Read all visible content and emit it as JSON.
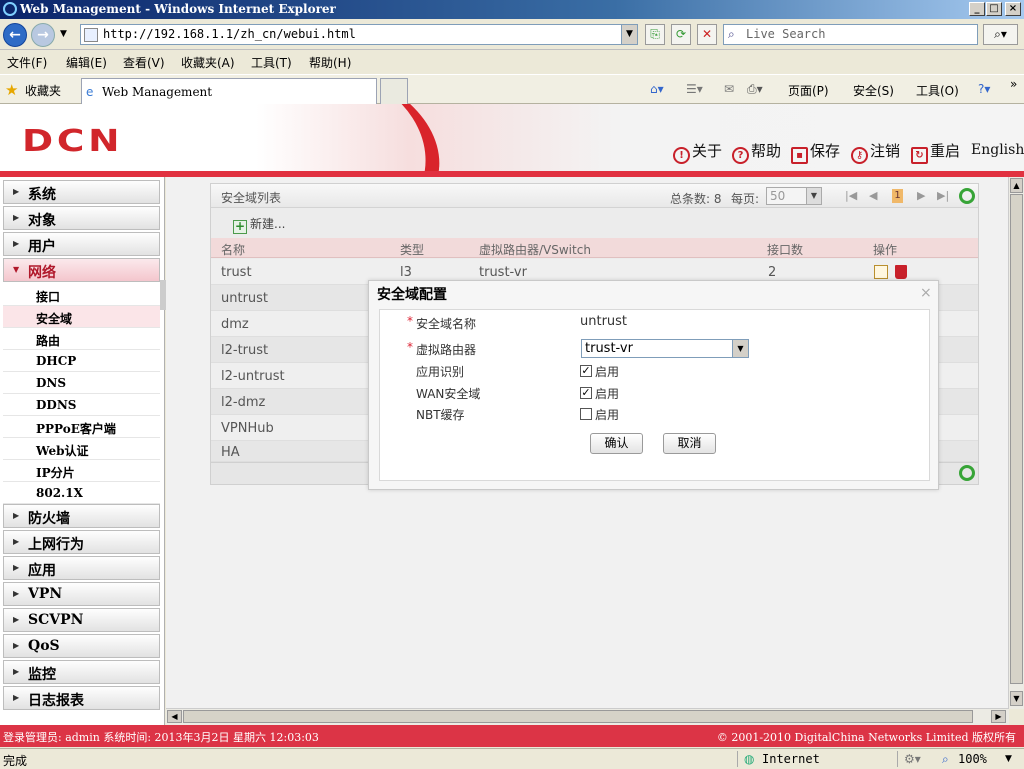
{
  "window": {
    "title": "Web Management - Windows Internet Explorer"
  },
  "addressbar": {
    "url": "http://192.168.1.1/zh_cn/webui.html",
    "search_placeholder": "Live Search"
  },
  "menubar": {
    "items": [
      "文件(F)",
      "编辑(E)",
      "查看(V)",
      "收藏夹(A)",
      "工具(T)",
      "帮助(H)"
    ]
  },
  "favbar": {
    "favorites_label": "收藏夹",
    "tab_title": "Web Management",
    "tools": [
      "页面(P)",
      "安全(S)",
      "工具(O)"
    ]
  },
  "banner": {
    "logo": "DCN",
    "links": [
      "关于",
      "帮助",
      "保存",
      "注销",
      "重启",
      "English"
    ]
  },
  "sidebar": {
    "groups": [
      "系统",
      "对象",
      "用户",
      "网络",
      "防火墙",
      "上网行为",
      "应用",
      "VPN",
      "SCVPN",
      "QoS",
      "监控",
      "日志报表"
    ],
    "network_sub": [
      "接口",
      "安全域",
      "路由",
      "DHCP",
      "DNS",
      "DDNS",
      "PPPoE客户端",
      "Web认证",
      "IP分片",
      "802.1X"
    ]
  },
  "panel": {
    "title": "安全域列表",
    "total_label": "总条数: 8",
    "per_page_label": "每页:",
    "per_page_value": "50",
    "current_page": "1",
    "new_button": "新建...",
    "columns": [
      "名称",
      "类型",
      "虚拟路由器/VSwitch",
      "接口数",
      "操作"
    ],
    "rows": [
      {
        "name": "trust",
        "type": "l3",
        "vr": "trust-vr",
        "count": "2"
      },
      {
        "name": "untrust",
        "type": "",
        "vr": "",
        "count": ""
      },
      {
        "name": "dmz",
        "type": "",
        "vr": "",
        "count": ""
      },
      {
        "name": "l2-trust",
        "type": "",
        "vr": "",
        "count": ""
      },
      {
        "name": "l2-untrust",
        "type": "",
        "vr": "",
        "count": ""
      },
      {
        "name": "l2-dmz",
        "type": "",
        "vr": "",
        "count": ""
      },
      {
        "name": "VPNHub",
        "type": "",
        "vr": "",
        "count": ""
      },
      {
        "name": "HA",
        "type": "",
        "vr": "",
        "count": ""
      }
    ]
  },
  "modal": {
    "title": "安全域配置",
    "close": "×",
    "zone_name_label": "安全域名称",
    "zone_name_value": "untrust",
    "vr_label": "虚拟路由器",
    "vr_value": "trust-vr",
    "app_id_label": "应用识别",
    "app_id_checked": true,
    "wan_label": "WAN安全域",
    "wan_checked": true,
    "nbt_label": "NBT缓存",
    "nbt_checked": false,
    "enable_label": "启用",
    "ok_button": "确认",
    "cancel_button": "取消"
  },
  "sysbar": {
    "left": "登录管理员: admin 系统时间: 2013年3月2日 星期六 12:03:03",
    "right": "© 2001-2010 DigitalChina Networks Limited 版权所有"
  },
  "statusbar": {
    "status": "完成",
    "zone": "Internet",
    "zoom": "100%"
  }
}
